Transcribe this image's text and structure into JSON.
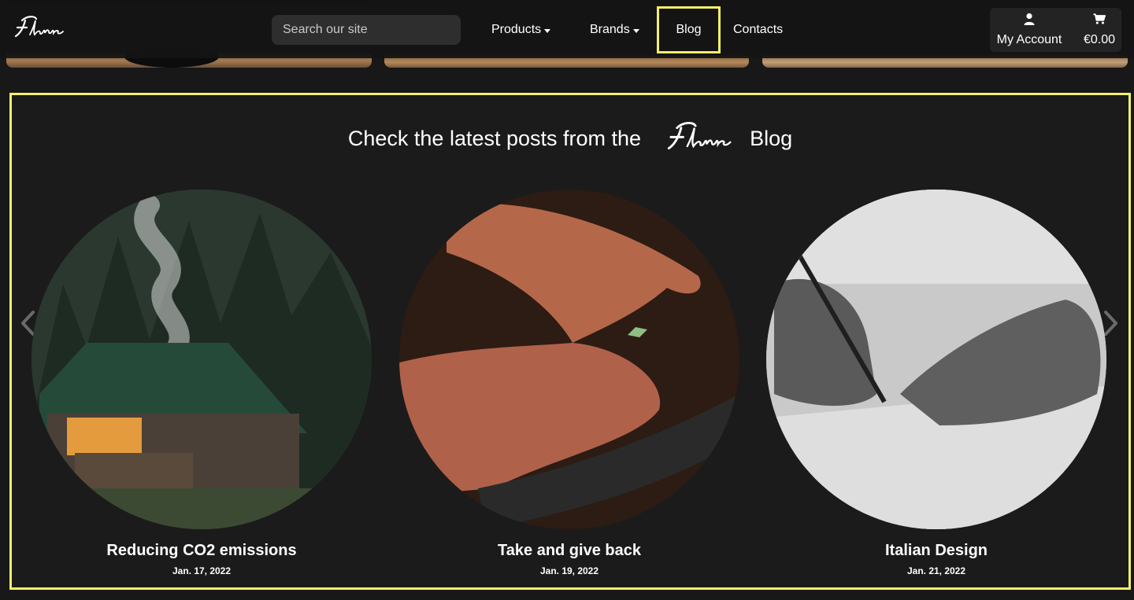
{
  "brand": {
    "name": "Flame"
  },
  "search": {
    "placeholder": "Search our site"
  },
  "nav": {
    "products": "Products",
    "brands": "Brands",
    "blog": "Blog",
    "contacts": "Contacts"
  },
  "account": {
    "label": "My Account"
  },
  "cart": {
    "total": "€0.00"
  },
  "blog_section": {
    "title_prefix": "Check the latest posts from the",
    "title_suffix": "Blog"
  },
  "posts": [
    {
      "title": "Reducing CO2 emissions",
      "date": "Jan. 17, 2022"
    },
    {
      "title": "Take and give back",
      "date": "Jan. 19, 2022"
    },
    {
      "title": "Italian Design",
      "date": "Jan. 21, 2022"
    }
  ],
  "colors": {
    "highlight": "#f3f06a",
    "background": "#1b1b1b",
    "navbar": "#141414"
  }
}
